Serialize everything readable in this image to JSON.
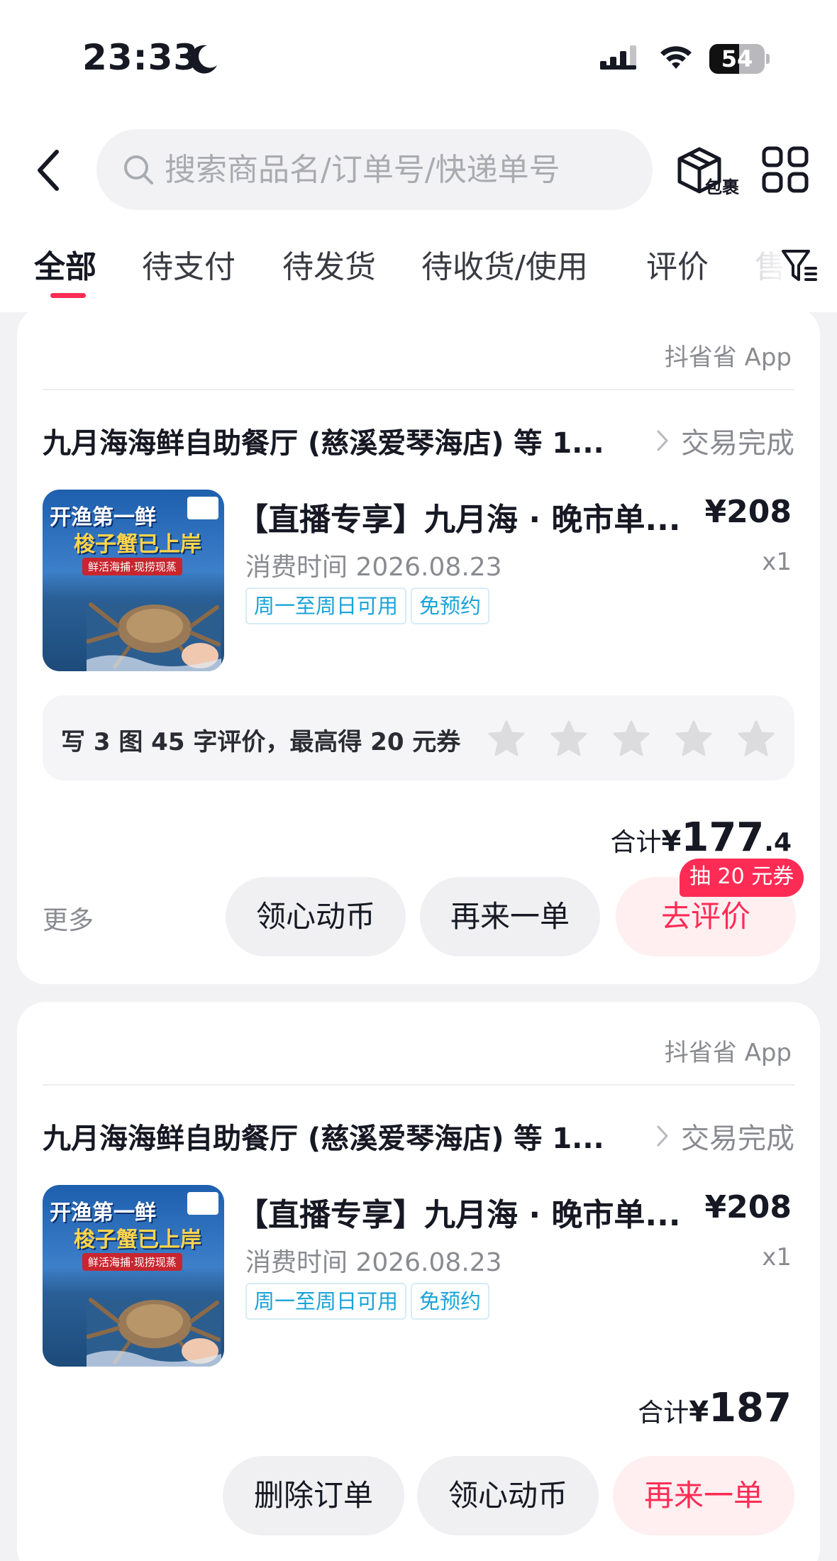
{
  "status_bar": {
    "time": "23:33",
    "battery": "54",
    "battery_level": 0.54
  },
  "search": {
    "placeholder": "搜索商品名/订单号/快递单号",
    "value": ""
  },
  "header": {
    "package_label": "包裹"
  },
  "tabs": [
    {
      "label": "全部",
      "active": true
    },
    {
      "label": "待支付",
      "active": false
    },
    {
      "label": "待发货",
      "active": false
    },
    {
      "label": "待收货/使用",
      "active": false
    },
    {
      "label": "评价",
      "active": false
    },
    {
      "label": "售",
      "active": false
    }
  ],
  "orders": [
    {
      "source": "抖省省 App",
      "shop": "九月海海鲜自助餐厅 (慈溪爱琴海店) 等 1...",
      "status": "交易完成",
      "product": {
        "title": "【直播专享】九月海 · 晚市单...",
        "price": "¥208",
        "consume_time": "消费时间 2026.08.23",
        "qty": "x1",
        "tags": [
          "周一至周日可用",
          "免预约"
        ],
        "image_text": {
          "line1": "开渔第一鲜",
          "line2": "梭子蟹已上岸",
          "line3": "鲜活海捕·现捞现蒸"
        }
      },
      "review_prompt": "写 3 图 45 字评价，最高得 20 元券",
      "rating": 0,
      "total": {
        "label": "合计",
        "yen": "¥",
        "integer": "177",
        "decimal": ".4"
      },
      "more_label": "更多",
      "buttons": [
        "领心动币",
        "再来一单",
        "去评价"
      ],
      "badge": "抽 20 元券"
    },
    {
      "source": "抖省省 App",
      "shop": "九月海海鲜自助餐厅 (慈溪爱琴海店) 等 1...",
      "status": "交易完成",
      "product": {
        "title": "【直播专享】九月海 · 晚市单...",
        "price": "¥208",
        "consume_time": "消费时间 2026.08.23",
        "qty": "x1",
        "tags": [
          "周一至周日可用",
          "免预约"
        ],
        "image_text": {
          "line1": "开渔第一鲜",
          "line2": "梭子蟹已上岸",
          "line3": "鲜活海捕·现捞现蒸"
        }
      },
      "total": {
        "label": "合计",
        "yen": "¥",
        "integer": "187",
        "decimal": ""
      },
      "buttons": [
        "删除订单",
        "领心动币",
        "再来一单"
      ]
    }
  ],
  "colors": {
    "accent": "#fe2c55",
    "tag_blue": "#1aa3d9",
    "muted": "#8a8b91",
    "background": "#f2f2f4"
  }
}
